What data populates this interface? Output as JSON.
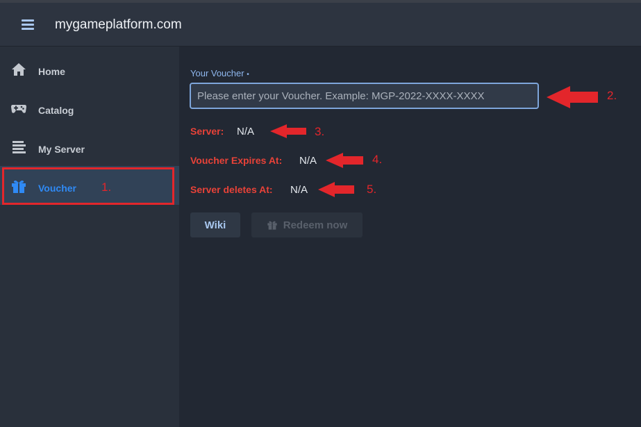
{
  "header": {
    "title": "mygameplatform.com"
  },
  "sidebar": {
    "items": [
      {
        "label": "Home",
        "icon": "home-icon"
      },
      {
        "label": "Catalog",
        "icon": "gamepad-icon"
      },
      {
        "label": "My Server",
        "icon": "server-icon"
      },
      {
        "label": "Voucher",
        "icon": "gift-icon",
        "active": true
      }
    ]
  },
  "voucher": {
    "label": "Your Voucher",
    "required_marker": "•",
    "placeholder": "Please enter your Voucher. Example: MGP-2022-XXXX-XXXX",
    "value": ""
  },
  "info": {
    "server_label": "Server:",
    "server_value": "N/A",
    "expires_label": "Voucher Expires At:",
    "expires_value": "N/A",
    "deletes_label": "Server deletes At:",
    "deletes_value": "N/A"
  },
  "buttons": {
    "wiki": "Wiki",
    "redeem": "Redeem now",
    "redeem_disabled": true
  },
  "annotations": {
    "n1": "1.",
    "n2": "2.",
    "n3": "3.",
    "n4": "4.",
    "n5": "5."
  },
  "colors": {
    "accent": "#2f8af5",
    "annotation_red": "#e3262b",
    "label_red": "#e84238",
    "input_border": "#7ea6db"
  }
}
